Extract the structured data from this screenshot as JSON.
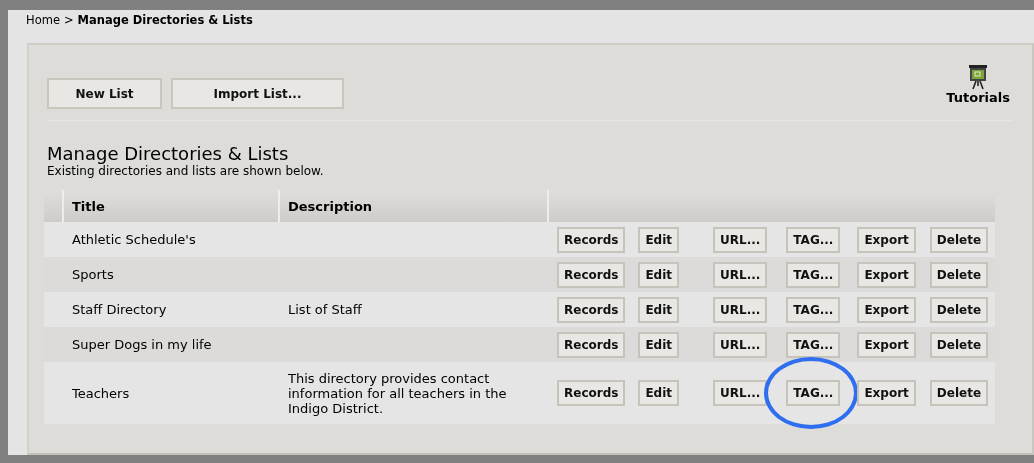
{
  "breadcrumb": {
    "home": "Home",
    "separator": ">",
    "current": "Manage Directories & Lists"
  },
  "toolbar": {
    "buttons": [
      "New List",
      "Import List..."
    ],
    "tutorials": "Tutorials"
  },
  "heading": {
    "title": "Manage Directories & Lists",
    "subtitle": "Existing directories and lists are shown below."
  },
  "table": {
    "columns": [
      "Title",
      "Description"
    ],
    "rows": [
      {
        "title": "Athletic Schedule's",
        "actions": [
          {
            "label": "Records",
            "circled": false
          },
          {
            "label": "Edit",
            "circled": false
          },
          {
            "label": "URL...",
            "circled": false
          },
          {
            "label": "TAG...",
            "circled": false
          },
          {
            "label": "Export",
            "circled": false
          },
          {
            "label": "Delete",
            "circled": false
          }
        ]
      },
      {
        "title": "Sports",
        "actions": [
          {
            "label": "Records",
            "circled": false
          },
          {
            "label": "Edit",
            "circled": false
          },
          {
            "label": "URL...",
            "circled": false
          },
          {
            "label": "TAG...",
            "circled": false
          },
          {
            "label": "Export",
            "circled": false
          },
          {
            "label": "Delete",
            "circled": false
          }
        ]
      },
      {
        "title": "Staff Directory",
        "description": "List of Staff",
        "actions": [
          {
            "label": "Records",
            "circled": false
          },
          {
            "label": "Edit",
            "circled": false
          },
          {
            "label": "URL...",
            "circled": false
          },
          {
            "label": "TAG...",
            "circled": false
          },
          {
            "label": "Export",
            "circled": false
          },
          {
            "label": "Delete",
            "circled": false
          }
        ]
      },
      {
        "title": "Super Dogs in my life",
        "actions": [
          {
            "label": "Records",
            "circled": false
          },
          {
            "label": "Edit",
            "circled": false
          },
          {
            "label": "URL...",
            "circled": false
          },
          {
            "label": "TAG...",
            "circled": false
          },
          {
            "label": "Export",
            "circled": false
          },
          {
            "label": "Delete",
            "circled": false
          }
        ]
      },
      {
        "title": "Teachers",
        "description": "This directory provides contact information for all teachers in the Indigo District.",
        "actions": [
          {
            "label": "Records",
            "circled": false
          },
          {
            "label": "Edit",
            "circled": false
          },
          {
            "label": "URL...",
            "circled": false
          },
          {
            "label": "TAG...",
            "circled": true
          },
          {
            "label": "Export",
            "circled": false
          },
          {
            "label": "Delete",
            "circled": false
          }
        ]
      }
    ]
  }
}
